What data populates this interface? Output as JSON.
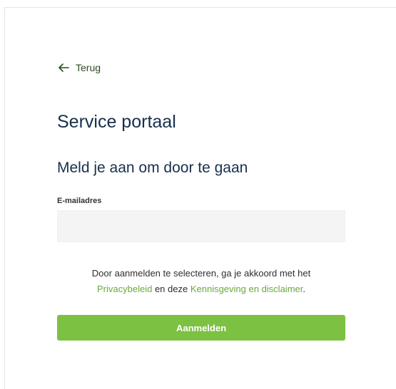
{
  "back_link": {
    "label": "Terug",
    "icon": "arrow-left-icon"
  },
  "page": {
    "title": "Service portaal",
    "subtitle": "Meld je aan om door te gaan"
  },
  "form": {
    "email_label": "E-mailadres",
    "email_value": "",
    "email_placeholder": "",
    "terms_prefix": "Door aanmelden te selecteren, ga je akkoord met het",
    "privacy_link": "Privacybeleid",
    "terms_middle": "en deze",
    "disclaimer_link": "Kennisgeving en disclaimer",
    "terms_suffix": ".",
    "submit_label": "Aanmelden"
  },
  "colors": {
    "accent": "#7dc142",
    "link": "#6aa93a",
    "heading": "#17304c",
    "input_bg": "#f4f4f4"
  }
}
